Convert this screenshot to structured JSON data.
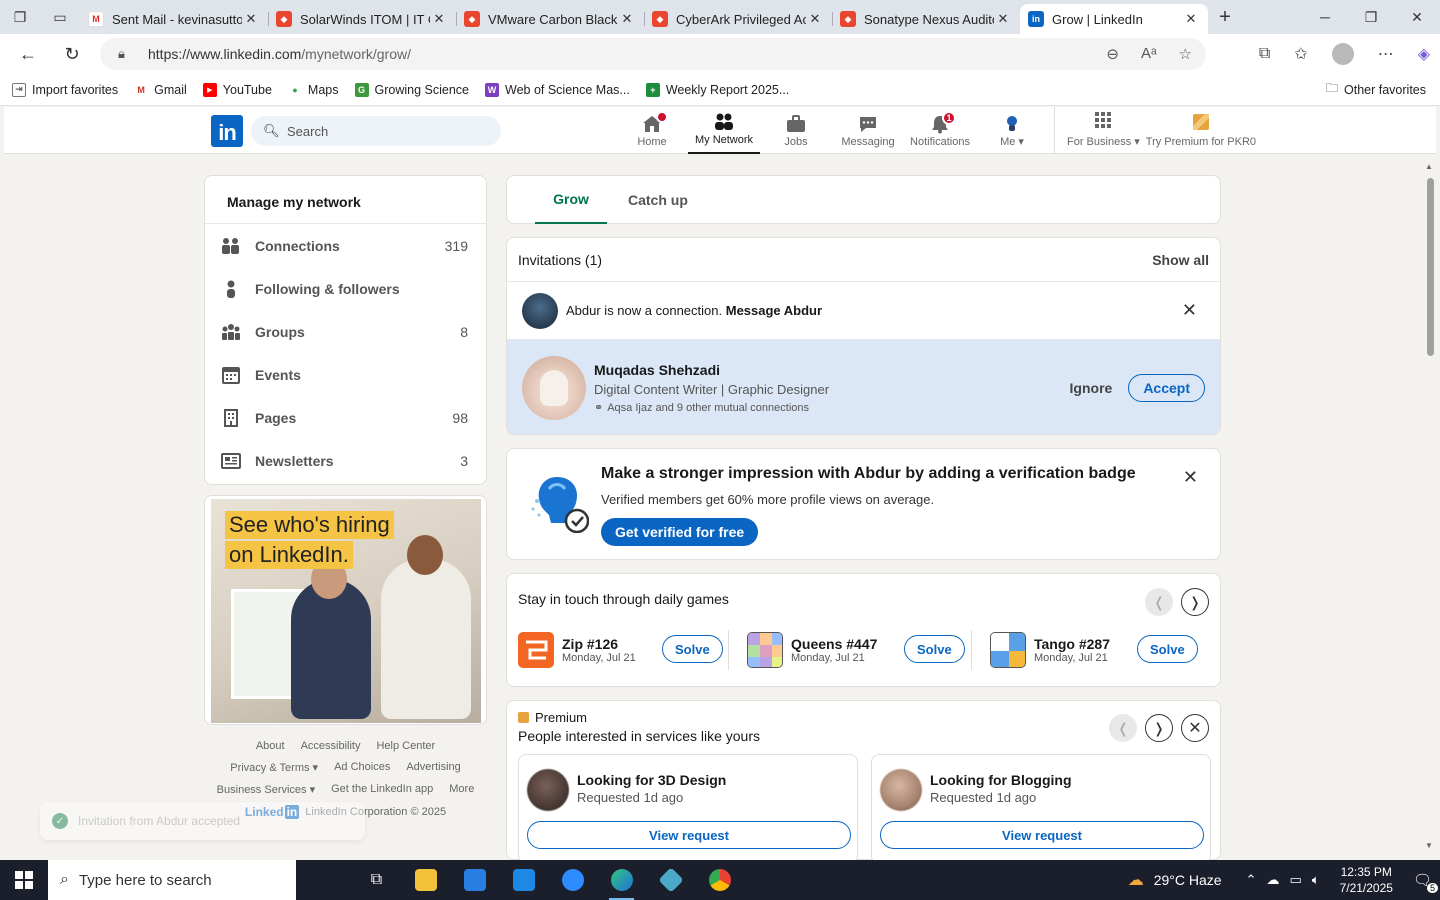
{
  "browser": {
    "tabs": [
      {
        "title": "Sent Mail - kevinasuttor",
        "color": "#d93025",
        "glyph": "M"
      },
      {
        "title": "SolarWinds ITOM | IT Op",
        "color": "#e8462e",
        "glyph": "◆"
      },
      {
        "title": "VMware Carbon Black E",
        "color": "#e8462e",
        "glyph": "◆"
      },
      {
        "title": "CyberArk Privileged Acc",
        "color": "#e8462e",
        "glyph": "◆"
      },
      {
        "title": "Sonatype Nexus Audito",
        "color": "#e8462e",
        "glyph": "◆"
      },
      {
        "title": "Grow | LinkedIn",
        "color": "#0a66c2",
        "glyph": "in",
        "active": true
      }
    ],
    "url_prefix": "https://www.linkedin.com",
    "url_path": "/mynetwork/grow/",
    "favorites": [
      {
        "label": "Import favorites",
        "color": "#555",
        "glyph": "⇥"
      },
      {
        "label": "Gmail",
        "color": "#d93025",
        "glyph": "M"
      },
      {
        "label": "YouTube",
        "color": "#ff0000",
        "glyph": "▶"
      },
      {
        "label": "Maps",
        "color": "#34a853",
        "glyph": "●"
      },
      {
        "label": "Growing Science",
        "color": "#3c9a3c",
        "glyph": "G"
      },
      {
        "label": "Web of Science Mas...",
        "color": "#7b3fbf",
        "glyph": "W"
      },
      {
        "label": "Weekly Report 2025...",
        "color": "#1e8e3e",
        "glyph": "+"
      }
    ],
    "other_favorites": "Other favorites"
  },
  "linkedin": {
    "logo": "in",
    "search_placeholder": "Search",
    "nav": [
      {
        "label": "Home",
        "badge": ""
      },
      {
        "label": "My Network",
        "badge": "",
        "active": true
      },
      {
        "label": "Jobs",
        "badge": ""
      },
      {
        "label": "Messaging",
        "badge": ""
      },
      {
        "label": "Notifications",
        "badge": "1"
      },
      {
        "label": "Me ▾",
        "badge": ""
      }
    ],
    "for_business": "For Business ▾",
    "premium_cta": "Try Premium for PKR0"
  },
  "manage": {
    "title": "Manage my network",
    "items": [
      {
        "label": "Connections",
        "count": "319"
      },
      {
        "label": "Following & followers",
        "count": ""
      },
      {
        "label": "Groups",
        "count": "8"
      },
      {
        "label": "Events",
        "count": ""
      },
      {
        "label": "Pages",
        "count": "98"
      },
      {
        "label": "Newsletters",
        "count": "3"
      }
    ]
  },
  "ad": {
    "line1": "See who's hiring",
    "line2": "on LinkedIn."
  },
  "footer": {
    "row1": [
      "About",
      "Accessibility",
      "Help Center"
    ],
    "row2": [
      "Privacy & Terms ▾",
      "Ad Choices",
      "Advertising"
    ],
    "row3": [
      "Business Services ▾",
      "Get the LinkedIn app",
      "More"
    ],
    "brand": "Linked",
    "copyright": "LinkedIn Corporation © 2025"
  },
  "toast": "Invitation from Abdur accepted",
  "tabs": {
    "grow": "Grow",
    "catchup": "Catch up"
  },
  "invitations": {
    "title": "Invitations (1)",
    "show_all": "Show all",
    "accepted_text": "Abdur is now a connection.",
    "accepted_link": "Message Abdur",
    "name": "Muqadas Shehzadi",
    "headline": "Digital Content Writer | Graphic Designer",
    "mutual": "Aqsa Ijaz and 9 other mutual connections",
    "ignore": "Ignore",
    "accept": "Accept"
  },
  "verify": {
    "title": "Make a stronger impression with Abdur by adding a verification badge",
    "subtitle": "Verified members get 60% more profile views on average.",
    "button": "Get verified for free"
  },
  "games": {
    "title": "Stay in touch through daily games",
    "items": [
      {
        "name": "Zip #126",
        "date": "Monday, Jul 21",
        "solve": "Solve"
      },
      {
        "name": "Queens #447",
        "date": "Monday, Jul 21",
        "solve": "Solve"
      },
      {
        "name": "Tango #287",
        "date": "Monday, Jul 21",
        "solve": "Solve"
      }
    ]
  },
  "premium": {
    "tag": "Premium",
    "subtitle": "People interested in services like yours",
    "requests": [
      {
        "title": "Looking for 3D Design",
        "sub": "Requested 1d ago",
        "button": "View request"
      },
      {
        "title": "Looking for Blogging",
        "sub": "Requested 1d ago",
        "button": "View request"
      }
    ]
  },
  "taskbar": {
    "search_placeholder": "Type here to search",
    "weather": "29°C  Haze",
    "time": "12:35 PM",
    "date": "7/21/2025",
    "notif_count": "5"
  }
}
